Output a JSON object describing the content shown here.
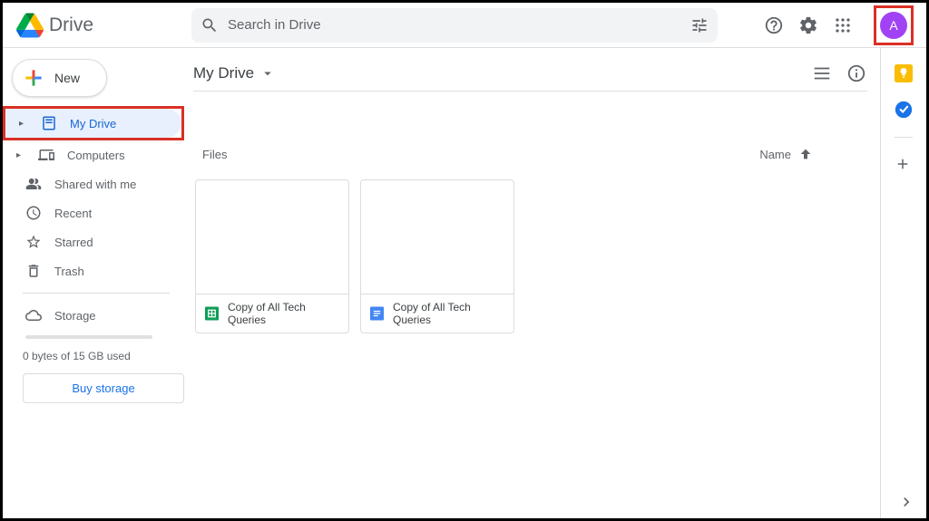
{
  "header": {
    "app_name": "Drive",
    "search_placeholder": "Search in Drive",
    "avatar_letter": "A"
  },
  "sidebar": {
    "new_label": "New",
    "items": [
      {
        "label": "My Drive"
      },
      {
        "label": "Computers"
      },
      {
        "label": "Shared with me"
      },
      {
        "label": "Recent"
      },
      {
        "label": "Starred"
      },
      {
        "label": "Trash"
      }
    ],
    "storage_label": "Storage",
    "storage_usage": "0 bytes of 15 GB used",
    "buy_label": "Buy storage"
  },
  "content": {
    "breadcrumb": "My Drive",
    "section_label": "Files",
    "sort_label": "Name",
    "files": [
      {
        "name": "Copy of All Tech Queries",
        "type": "sheets"
      },
      {
        "name": "Copy of All Tech Queries",
        "type": "docs"
      }
    ]
  }
}
